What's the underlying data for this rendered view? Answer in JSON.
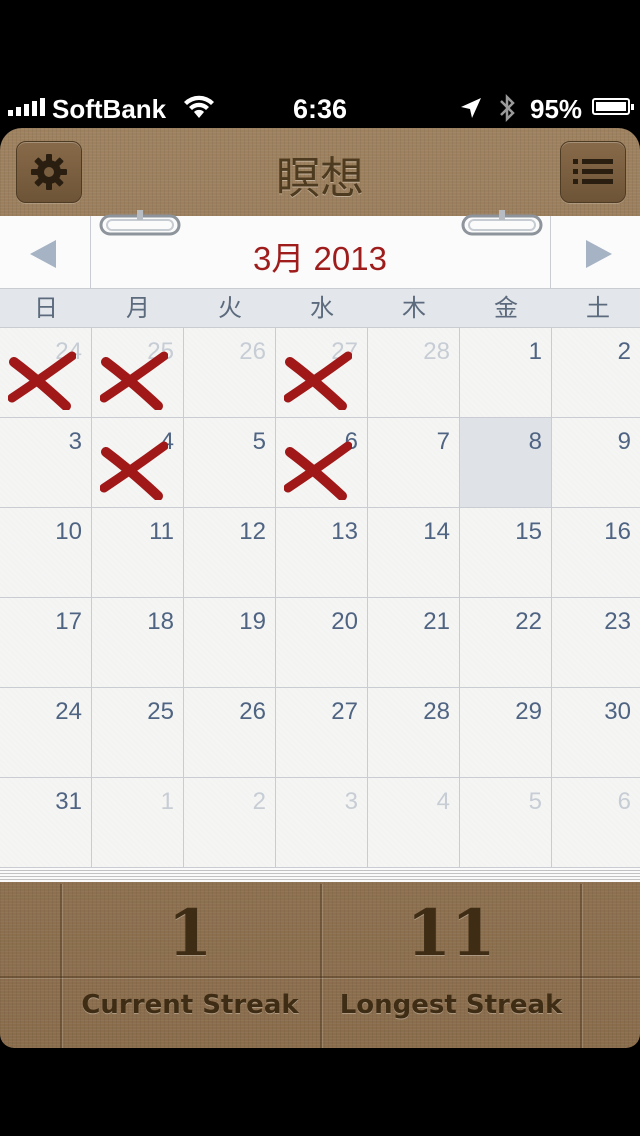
{
  "status_bar": {
    "carrier": "SoftBank",
    "time": "6:36",
    "battery_percent": "95%",
    "icons": [
      "signal-icon",
      "wifi-icon",
      "location-icon",
      "bluetooth-icon",
      "battery-icon"
    ]
  },
  "header": {
    "title": "瞑想",
    "settings_icon": "gear-icon",
    "list_icon": "list-icon"
  },
  "calendar": {
    "month_label": "3月 2013",
    "weekdays": [
      "日",
      "月",
      "火",
      "水",
      "木",
      "金",
      "土"
    ],
    "weeks": [
      [
        {
          "d": "24",
          "cur": false,
          "x": true
        },
        {
          "d": "25",
          "cur": false,
          "x": true
        },
        {
          "d": "26",
          "cur": false
        },
        {
          "d": "27",
          "cur": false,
          "x": true
        },
        {
          "d": "28",
          "cur": false
        },
        {
          "d": "1",
          "cur": true
        },
        {
          "d": "2",
          "cur": true
        }
      ],
      [
        {
          "d": "3",
          "cur": true
        },
        {
          "d": "4",
          "cur": true,
          "x": true
        },
        {
          "d": "5",
          "cur": true
        },
        {
          "d": "6",
          "cur": true,
          "x": true
        },
        {
          "d": "7",
          "cur": true
        },
        {
          "d": "8",
          "cur": true,
          "today": true
        },
        {
          "d": "9",
          "cur": true
        }
      ],
      [
        {
          "d": "10",
          "cur": true
        },
        {
          "d": "11",
          "cur": true
        },
        {
          "d": "12",
          "cur": true
        },
        {
          "d": "13",
          "cur": true
        },
        {
          "d": "14",
          "cur": true
        },
        {
          "d": "15",
          "cur": true
        },
        {
          "d": "16",
          "cur": true
        }
      ],
      [
        {
          "d": "17",
          "cur": true
        },
        {
          "d": "18",
          "cur": true
        },
        {
          "d": "19",
          "cur": true
        },
        {
          "d": "20",
          "cur": true
        },
        {
          "d": "21",
          "cur": true
        },
        {
          "d": "22",
          "cur": true
        },
        {
          "d": "23",
          "cur": true
        }
      ],
      [
        {
          "d": "24",
          "cur": true
        },
        {
          "d": "25",
          "cur": true
        },
        {
          "d": "26",
          "cur": true
        },
        {
          "d": "27",
          "cur": true
        },
        {
          "d": "28",
          "cur": true
        },
        {
          "d": "29",
          "cur": true
        },
        {
          "d": "30",
          "cur": true
        }
      ],
      [
        {
          "d": "31",
          "cur": true
        },
        {
          "d": "1",
          "cur": false
        },
        {
          "d": "2",
          "cur": false
        },
        {
          "d": "3",
          "cur": false
        },
        {
          "d": "4",
          "cur": false
        },
        {
          "d": "5",
          "cur": false
        },
        {
          "d": "6",
          "cur": false
        }
      ]
    ],
    "colors": {
      "month": "#9e1c1c",
      "day_number": "#4f6482",
      "other_month": "#c7cdd5",
      "mark": "#a01818",
      "today_bg": "#dfe2e7"
    }
  },
  "stats": {
    "current_streak_value": "1",
    "current_streak_label": "Current Streak",
    "longest_streak_value": "11",
    "longest_streak_label": "Longest Streak"
  }
}
